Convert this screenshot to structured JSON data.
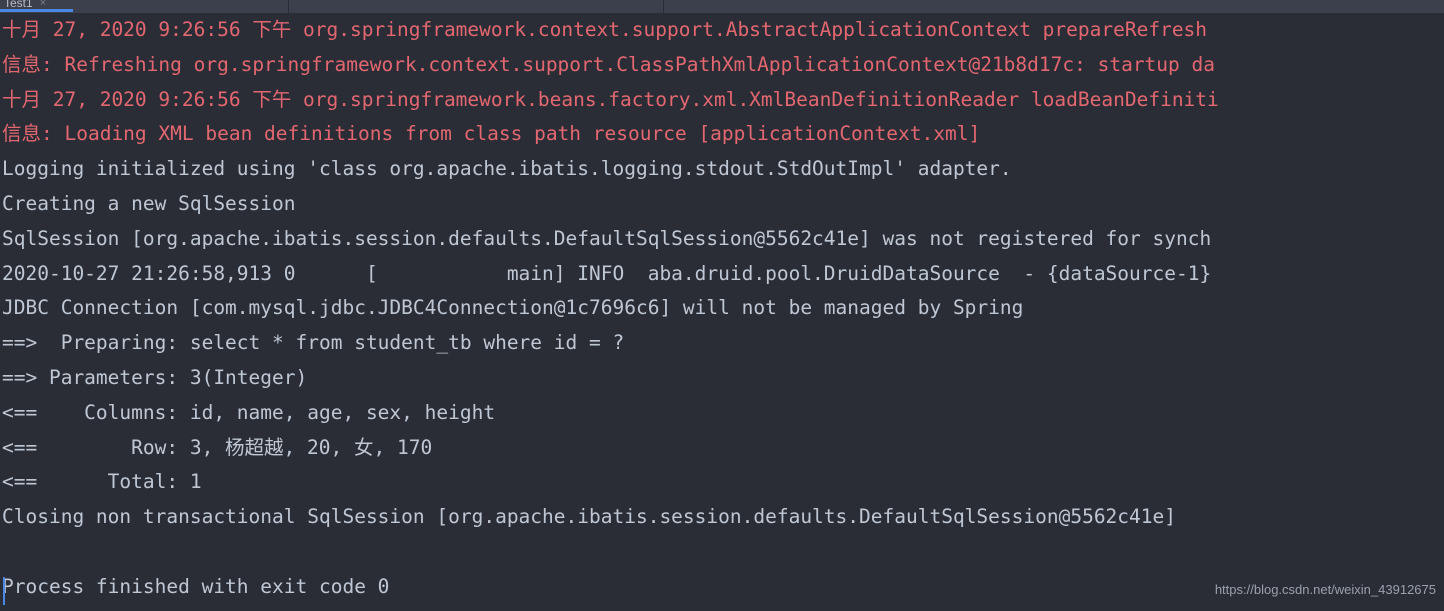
{
  "window": {
    "background_color": "#2b2d36",
    "console_background_color": "#2b2d36"
  },
  "tabbar": {
    "background_color": "#3c3f4c",
    "active_indicator_color": "#4a88e8",
    "tabs": [
      {
        "label": "Test1",
        "close_glyph": "×",
        "active": true
      }
    ]
  },
  "console": {
    "error_color": "#e36770",
    "output_color": "#bfc7d4",
    "lines": [
      {
        "stream": "err",
        "text": "十月 27, 2020 9:26:56 下午 org.springframework.context.support.AbstractApplicationContext prepareRefresh"
      },
      {
        "stream": "err",
        "text": "信息: Refreshing org.springframework.context.support.ClassPathXmlApplicationContext@21b8d17c: startup da"
      },
      {
        "stream": "err",
        "text": "十月 27, 2020 9:26:56 下午 org.springframework.beans.factory.xml.XmlBeanDefinitionReader loadBeanDefiniti"
      },
      {
        "stream": "err",
        "text": "信息: Loading XML bean definitions from class path resource [applicationContext.xml]"
      },
      {
        "stream": "out",
        "text": "Logging initialized using 'class org.apache.ibatis.logging.stdout.StdOutImpl' adapter."
      },
      {
        "stream": "out",
        "text": "Creating a new SqlSession"
      },
      {
        "stream": "out",
        "text": "SqlSession [org.apache.ibatis.session.defaults.DefaultSqlSession@5562c41e] was not registered for synch"
      },
      {
        "stream": "out",
        "text": "2020-10-27 21:26:58,913 0      [           main] INFO  aba.druid.pool.DruidDataSource  - {dataSource-1}"
      },
      {
        "stream": "out",
        "text": "JDBC Connection [com.mysql.jdbc.JDBC4Connection@1c7696c6] will not be managed by Spring"
      },
      {
        "stream": "out",
        "text": "==>  Preparing: select * from student_tb where id = ?"
      },
      {
        "stream": "out",
        "text": "==> Parameters: 3(Integer)"
      },
      {
        "stream": "out",
        "text": "<==    Columns: id, name, age, sex, height"
      },
      {
        "stream": "out",
        "text": "<==        Row: 3, 杨超越, 20, 女, 170"
      },
      {
        "stream": "out",
        "text": "<==      Total: 1"
      },
      {
        "stream": "out",
        "text": "Closing non transactional SqlSession [org.apache.ibatis.session.defaults.DefaultSqlSession@5562c41e]"
      },
      {
        "stream": "blank",
        "text": " "
      },
      {
        "stream": "out",
        "text": "Process finished with exit code 0"
      }
    ]
  },
  "watermark": {
    "text": "https://blog.csdn.net/weixin_43912675"
  }
}
